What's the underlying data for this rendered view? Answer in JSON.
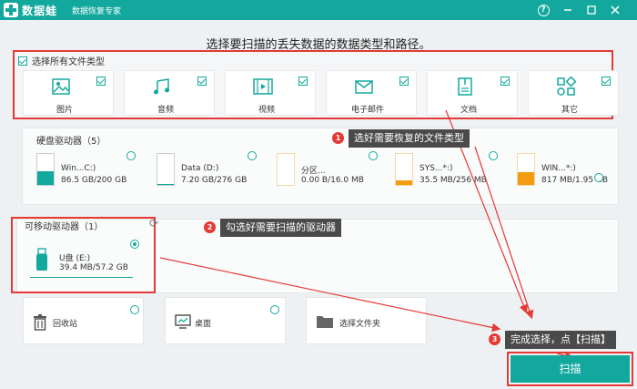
{
  "app": {
    "brand": "数据蛙",
    "subtitle": "数据恢复专家",
    "accent": "#13a89e",
    "highlight": "#e53935"
  },
  "window_controls": [
    "help-icon",
    "minimize-icon",
    "maximize-icon",
    "close-icon"
  ],
  "heading": "选择要扫描的丢失数据的数据类型和路径。",
  "file_types": {
    "select_all_label": "选择所有文件类型",
    "select_all_checked": true,
    "items": [
      {
        "label": "图片",
        "icon": "image-icon",
        "checked": true
      },
      {
        "label": "音频",
        "icon": "audio-icon",
        "checked": true
      },
      {
        "label": "视频",
        "icon": "video-icon",
        "checked": true
      },
      {
        "label": "电子邮件",
        "icon": "email-icon",
        "checked": true
      },
      {
        "label": "文档",
        "icon": "document-icon",
        "checked": true
      },
      {
        "label": "其它",
        "icon": "other-icon",
        "checked": true
      }
    ]
  },
  "hard_drives": {
    "title": "硬盘驱动器（5）",
    "items": [
      {
        "name": "Win...C:)",
        "size": "86.5 GB/200 GB",
        "fill_fraction": 0.43,
        "fill_color": "#13a89e"
      },
      {
        "name": "Data (D:)",
        "size": "7.20 GB/276 GB",
        "fill_fraction": 0.03,
        "fill_color": "#13a89e"
      },
      {
        "name": "分区...",
        "size": "0.00  B/16.0 MB",
        "fill_fraction": 0.0,
        "fill_color": "#13a89e"
      },
      {
        "name": "SYS...*:)",
        "size": "35.5 MB/256 MB",
        "fill_fraction": 0.14,
        "fill_color": "#f39c12"
      },
      {
        "name": "WIN...*:)",
        "size": "817 MB/1.95 GB",
        "fill_fraction": 0.41,
        "fill_color": "#f39c12"
      }
    ]
  },
  "removable": {
    "title": "可移动驱动器（1）",
    "items": [
      {
        "name": "U盘 (E:)",
        "size": "39.4 MB/57.2 GB",
        "selected": true
      }
    ]
  },
  "locations": [
    {
      "label": "回收站",
      "icon": "recycle-bin-icon"
    },
    {
      "label": "桌面",
      "icon": "desktop-icon"
    },
    {
      "label": "选择文件夹",
      "icon": "folder-icon"
    }
  ],
  "callouts": [
    {
      "num": "1",
      "text": "选好需要恢复的文件类型"
    },
    {
      "num": "2",
      "text": "勾选好需要扫描的驱动器"
    },
    {
      "num": "3",
      "text": "完成选择，点【扫描】"
    }
  ],
  "scan_button": "扫描"
}
